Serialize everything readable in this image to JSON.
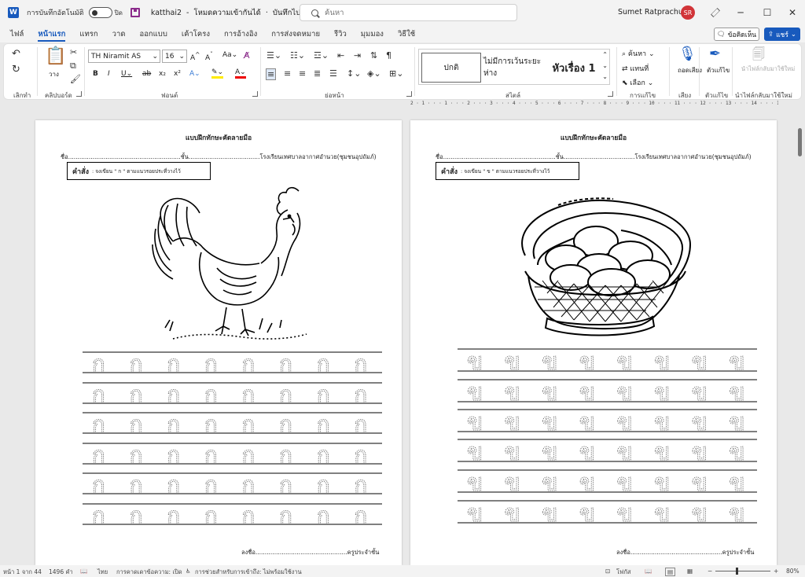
{
  "titlebar": {
    "app_icon": "word-logo",
    "autosave_label": "การบันทึกอัตโนมัติ",
    "autosave_state": "ปิด",
    "doc_name": "katthai2",
    "mode": "โหมดความเข้ากันได้",
    "saved_status": "บันทึกไปยัง พีซีนี้",
    "search_placeholder": "ค้นหา",
    "user_name": "Sumet Ratprachum",
    "user_initials": "SR"
  },
  "tabs": [
    "ไฟล์",
    "หน้าแรก",
    "แทรก",
    "วาด",
    "ออกแบบ",
    "เค้าโครง",
    "การอ้างอิง",
    "การส่งจดหมาย",
    "รีวิว",
    "มุมมอง",
    "วิธีใช้"
  ],
  "active_tab": "หน้าแรก",
  "actions": {
    "comments": "ข้อคิดเห็น",
    "share": "แชร์"
  },
  "ribbon": {
    "undo_group": "เลิกทำ",
    "clipboard": {
      "label": "คลิปบอร์ด",
      "paste": "วาง"
    },
    "font": {
      "label": "ฟอนต์",
      "font_name": "TH Niramit AS",
      "font_size": "16"
    },
    "paragraph": {
      "label": "ย่อหน้า"
    },
    "styles": {
      "label": "สไตล์",
      "items": [
        "ปกติ",
        "ไม่มีการเว้นระยะห่าง",
        "หัวเรื่อง 1"
      ]
    },
    "editing": {
      "label": "การแก้ไข",
      "find": "ค้นหา",
      "replace": "แทนที่",
      "select": "เลือก"
    },
    "voice": {
      "label": "เสียง",
      "dictate": "ถอดเสียง"
    },
    "editor": {
      "label": "ตัวแก้ไข",
      "button": "ตัวแก้ไข"
    },
    "reuse": {
      "label": "นำไฟล์กลับมาใช้ใหม่",
      "button": "นำไฟล์กลับมาใช้ใหม่"
    }
  },
  "ruler_text": "2 · 1 · · · 1 · · · 2 · · · 3 · · · 4 · · · 5 · · · 6 · · · 7 · · · 8 · · · 9 · · · 10 · · · 11 · · · 12 · · · 13 · · · 14 · · · 15 · · · 16 · · · 17 · · · 18 ·",
  "pages": [
    {
      "title": "แบบฝึกทักษะคัดลายมือ",
      "name_line": "ชื่อ............................................................ชั้น......................................โรงเรียนเทศบาลอากาศอำนวย(ชุมชนอุปถัมภ์)",
      "instruction_label": "คำสั่ง",
      "instruction_text": ": จงเขียน  \" ก \" ตามแนวรอยประที่วางไว้",
      "picture": "rooster-illustration",
      "letter": "ก",
      "signature": "ลงชื่อ.................................................ครูประจำชั้น"
    },
    {
      "title": "แบบฝึกทักษะคัดลายมือ",
      "name_line": "ชื่อ............................................................ชั้น......................................โรงเรียนเทศบาลอากาศอำนวย(ชุมชนอุปถัมภ์)",
      "instruction_label": "คำสั่ง",
      "instruction_text": ": จงเขียน  \" ข \" ตามแนวรอยประที่วางไว้",
      "picture": "egg-basket-illustration",
      "letter": "ข",
      "signature": "ลงชื่อ.................................................ครูประจำชั้น"
    }
  ],
  "statusbar": {
    "page": "หน้า 1 จาก 44",
    "words": "1496 คำ",
    "language": "ไทย",
    "text_prediction": "การคาดเดาข้อความ: เปิด",
    "accessibility": "การช่วยสำหรับการเข้าถึง: ไม่พร้อมใช้งาน",
    "focus": "โฟกัส",
    "zoom": "80%"
  }
}
